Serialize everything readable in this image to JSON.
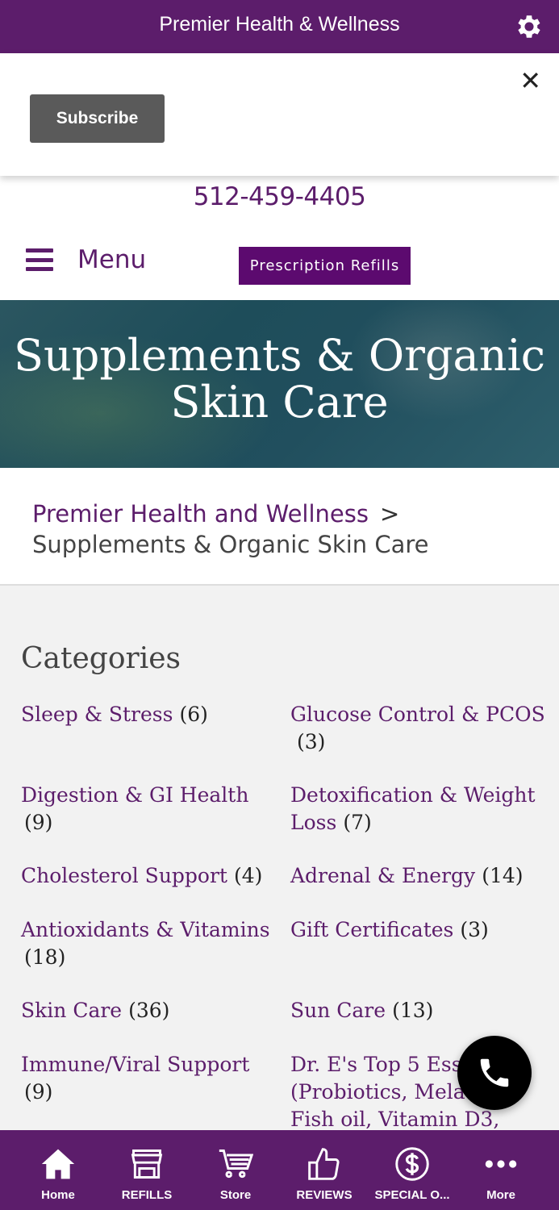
{
  "app": {
    "title": "Premier Health & Wellness"
  },
  "subscribe": {
    "button_label": "Subscribe",
    "close_glyph": "✕"
  },
  "header": {
    "phone": "512-459-4405",
    "menu_label": "Menu",
    "rx_button": "Prescription Refills"
  },
  "hero": {
    "title_line1": "Supplements & Organic",
    "title_line2": "Skin Care"
  },
  "breadcrumb": {
    "home": "Premier Health and Wellness",
    "separator": ">",
    "current": "Supplements & Organic Skin Care"
  },
  "categories": {
    "title": "Categories",
    "items": [
      {
        "name": "Sleep & Stress",
        "count": "(6)"
      },
      {
        "name": "Glucose Control & PCOS",
        "count": "(3)"
      },
      {
        "name": "Digestion & GI Health",
        "count": "(9)"
      },
      {
        "name": "Detoxification & Weight",
        "name2": "Loss",
        "count": "(7)"
      },
      {
        "name": "Cholesterol Support",
        "count": "(4)"
      },
      {
        "name": "Adrenal & Energy",
        "count": "(14)"
      },
      {
        "name": "Antioxidants & Vitamins",
        "count": "(18)"
      },
      {
        "name": "Gift Certificates",
        "count": "(3)"
      },
      {
        "name": "Skin Care",
        "count": "(36)"
      },
      {
        "name": "Sun Care",
        "count": "(13)"
      },
      {
        "name": "Immune/Viral Support",
        "count": "(9)"
      },
      {
        "name": "Dr. E's Top 5 Essen",
        "name2": "(Probiotics, Melato",
        "name3": "Fish oil, Vitamin D3,"
      }
    ]
  },
  "tabbar": {
    "tabs": [
      {
        "label": "Home",
        "icon": "home-icon"
      },
      {
        "label": "REFILLS",
        "icon": "storefront-icon"
      },
      {
        "label": "Store",
        "icon": "cart-icon"
      },
      {
        "label": "REVIEWS",
        "icon": "thumbs-up-icon"
      },
      {
        "label": "SPECIAL O...",
        "icon": "dollar-icon"
      },
      {
        "label": "More",
        "icon": "more-icon"
      }
    ]
  },
  "colors": {
    "brand": "#5c1d6b",
    "rx_button": "#5c0a6f",
    "subscribe": "#5a5a5a"
  }
}
